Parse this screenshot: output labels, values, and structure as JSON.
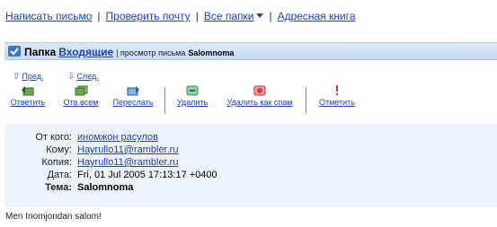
{
  "top_nav": {
    "compose": "Написать письмо",
    "check_mail": "Проверить почту",
    "all_folders": "Все папки",
    "address_book": "Адресная книга"
  },
  "folder_bar": {
    "label": "Папка",
    "folder": "Входящие",
    "view_text": "| просмотр письма",
    "subject": "Salomnoma"
  },
  "nav": {
    "prev": "Пред.",
    "next": "След."
  },
  "toolbar": {
    "reply": "Ответить",
    "reply_all": "Отв.всем",
    "forward": "Переслать",
    "delete": "Удалить",
    "delete_spam": "Удалить как спам",
    "mark": "Отметить"
  },
  "headers": {
    "from_label": "От кого:",
    "from_value": "иномжон расулов",
    "to_label": "Кому:",
    "to_value": "Hayrullo11@rambler.ru",
    "cc_label": "Копия:",
    "cc_value": "Hayrullo11@rambler.ru",
    "date_label": "Дата:",
    "date_value": "Fri, 01 Jul 2005 17:13:17 +0400",
    "subject_label": "Тема:",
    "subject_value": "Salomnoma"
  },
  "message": {
    "body": "Men Inomjondan salom!"
  },
  "colors": {
    "link": "#1a44c2",
    "header_bg": "#eef3fb",
    "folder_bar_bg": "#c8dbf2",
    "spam_red": "#d93a2b"
  },
  "icons": [
    "folder-icon",
    "prev-arrow-icon",
    "next-arrow-icon",
    "reply-icon",
    "reply-all-icon",
    "forward-icon",
    "delete-icon",
    "spam-icon",
    "flag-icon",
    "dropdown-arrow-icon"
  ]
}
